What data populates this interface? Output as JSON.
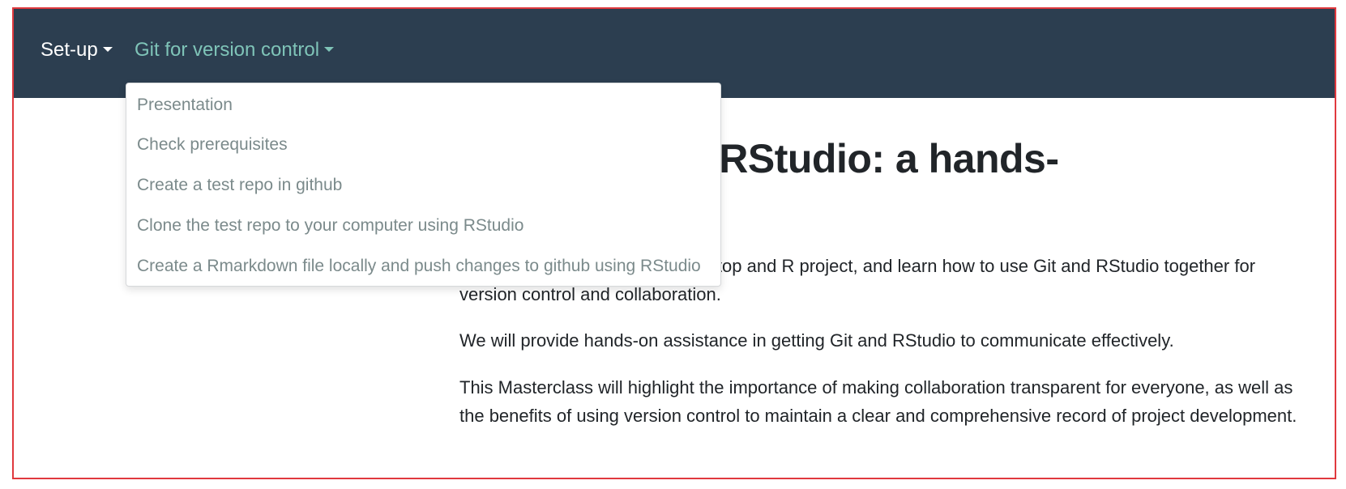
{
  "navbar": {
    "items": [
      {
        "label": "Set-up",
        "active": false
      },
      {
        "label": "Git for version control",
        "active": true
      }
    ],
    "colors": {
      "background": "#2c3e50",
      "active_text": "#7fc4b8",
      "text": "#ffffff"
    }
  },
  "dropdown": {
    "items": [
      "Presentation",
      "Check prerequisites",
      "Create a test repo in github",
      "Clone the test repo to your computer using RStudio",
      "Create a Rmarkdown file locally and push changes to github using RStudio"
    ]
  },
  "content": {
    "title": "ed with Git in RStudio: a hands-",
    "paragraphs": [
      "nity for you to bring your own laptop and R project, and learn how to use Git and RStudio together for version control and collaboration.",
      "We will provide hands-on assistance in getting Git and RStudio to communicate effectively.",
      "This Masterclass will highlight the importance of making collaboration transparent for everyone, as well as the benefits of using version control to maintain a clear and comprehensive record of project development."
    ]
  }
}
